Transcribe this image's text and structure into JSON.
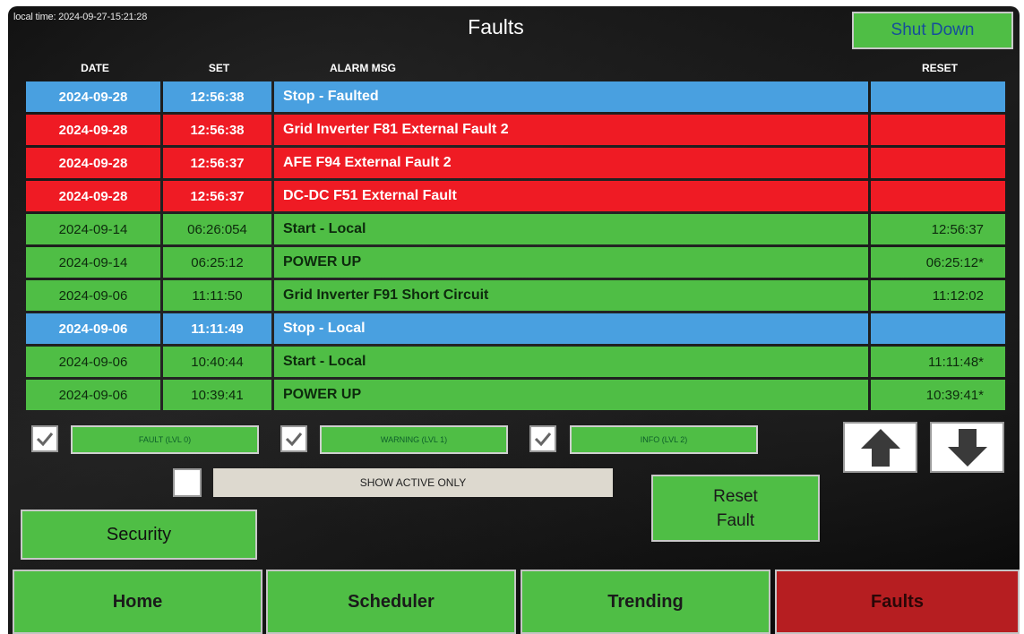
{
  "header": {
    "local_time": "local time: 2024-09-27-15:21:28",
    "title": "Faults",
    "shutdown_label": "Shut Down"
  },
  "table": {
    "columns": {
      "date": "DATE",
      "set": "SET",
      "msg": "ALARM MSG",
      "reset": "RESET"
    },
    "rows": [
      {
        "date": "2024-09-28",
        "set": "12:56:38",
        "msg": "Stop - Faulted",
        "reset": "",
        "level": "info"
      },
      {
        "date": "2024-09-28",
        "set": "12:56:38",
        "msg": "Grid Inverter F81 External Fault 2",
        "reset": "",
        "level": "fault"
      },
      {
        "date": "2024-09-28",
        "set": "12:56:37",
        "msg": "AFE F94 External Fault 2",
        "reset": "",
        "level": "fault"
      },
      {
        "date": "2024-09-28",
        "set": "12:56:37",
        "msg": "DC-DC F51 External Fault",
        "reset": "",
        "level": "fault"
      },
      {
        "date": "2024-09-14",
        "set": "06:26:054",
        "msg": "Start - Local",
        "reset": "12:56:37",
        "level": "ok"
      },
      {
        "date": "2024-09-14",
        "set": "06:25:12",
        "msg": "POWER UP",
        "reset": "06:25:12*",
        "level": "ok"
      },
      {
        "date": "2024-09-06",
        "set": "11:11:50",
        "msg": "Grid Inverter F91 Short Circuit",
        "reset": "11:12:02",
        "level": "ok"
      },
      {
        "date": "2024-09-06",
        "set": "11:11:49",
        "msg": "Stop - Local",
        "reset": "",
        "level": "info"
      },
      {
        "date": "2024-09-06",
        "set": "10:40:44",
        "msg": "Start - Local",
        "reset": "11:11:48*",
        "level": "ok"
      },
      {
        "date": "2024-09-06",
        "set": "10:39:41",
        "msg": "POWER UP",
        "reset": "10:39:41*",
        "level": "ok"
      }
    ]
  },
  "filters": {
    "fault_label": "FAULT (LVL 0)",
    "fault_checked": true,
    "warning_label": "WARNING (LVL 1)",
    "warning_checked": true,
    "info_label": "INFO (LVL 2)",
    "info_checked": true,
    "show_active_label": "SHOW ACTIVE ONLY",
    "show_active_checked": false
  },
  "actions": {
    "reset_fault_line1": "Reset",
    "reset_fault_line2": "Fault",
    "security_label": "Security"
  },
  "nav": {
    "home": "Home",
    "scheduler": "Scheduler",
    "trending": "Trending",
    "faults": "Faults",
    "active": "faults"
  },
  "icons": {
    "scroll_up": "arrow-up-icon",
    "scroll_down": "arrow-down-icon",
    "check": "checkmark-icon"
  },
  "colors": {
    "fault": "#ef1b24",
    "info": "#49a0e0",
    "ok": "#4fbe45",
    "nav_active": "#b61e21"
  }
}
